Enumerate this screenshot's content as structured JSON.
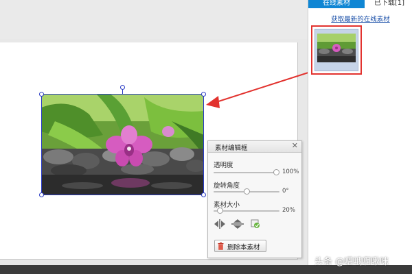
{
  "right_panel": {
    "tabs": [
      {
        "label": "在线素材",
        "active": true
      },
      {
        "label": "已下载[1]",
        "active": false
      }
    ],
    "fetch_link": "获取最新的在线素材"
  },
  "editor": {
    "title": "素材编辑框",
    "close_glyph": "✕",
    "opacity": {
      "label": "透明度",
      "value": 100,
      "value_text": "100%"
    },
    "rotation": {
      "label": "旋转角度",
      "value": 0,
      "value_text": "0°"
    },
    "size": {
      "label": "素材大小",
      "value": 20,
      "value_text": "20%"
    },
    "delete_label": "删除本素材",
    "icons": [
      "flip-horizontal-icon",
      "flip-vertical-icon",
      "replace-icon"
    ]
  },
  "watermark": "头条 @嗯哦啊啾咪",
  "colors": {
    "tab_active": "#0f86d4",
    "selection": "#2b3cc4",
    "highlight": "#e2322e",
    "link": "#1a4fa8"
  }
}
